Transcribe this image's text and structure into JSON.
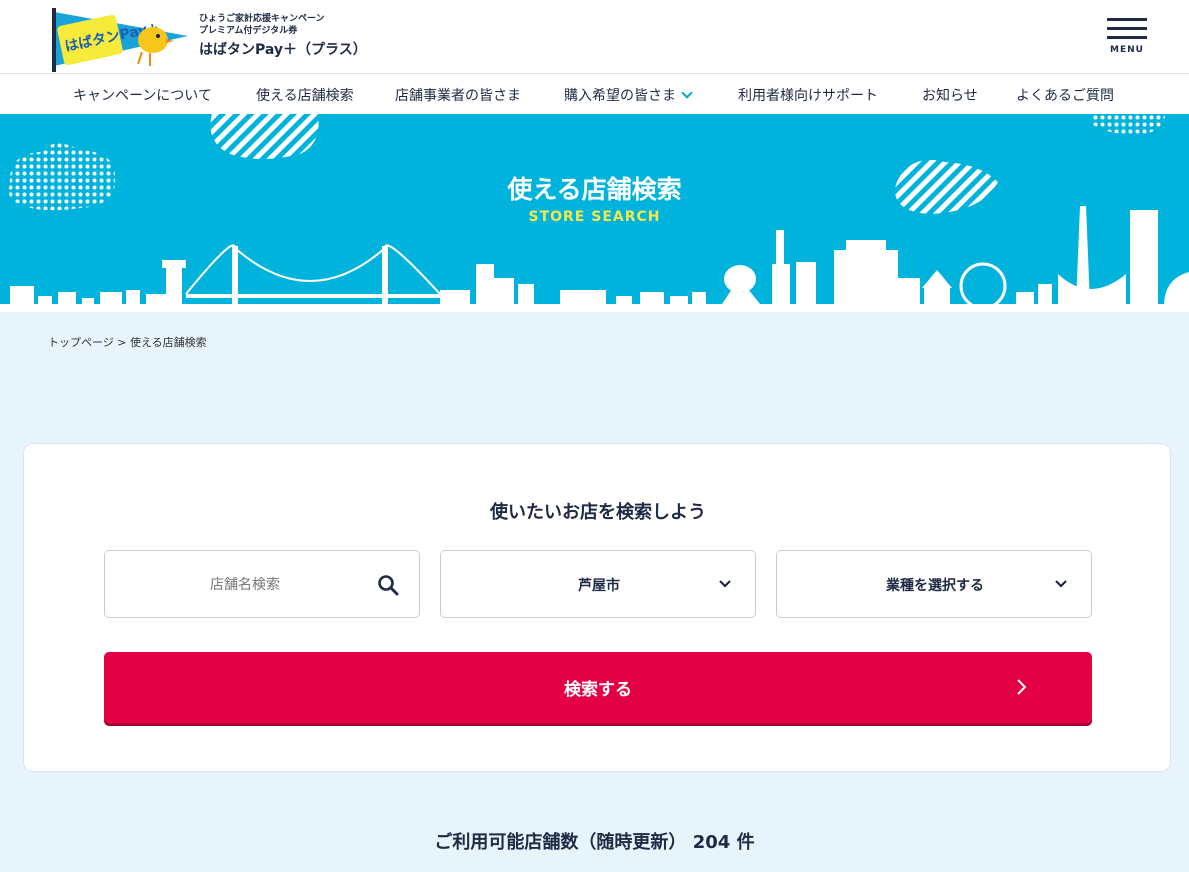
{
  "header": {
    "logo_text": "はばタンPay+",
    "subtitle_1": "ひょうご家計応援キャンペーン",
    "subtitle_2": "プレミアム付デジタル券",
    "title": "はばタンPay＋（プラス）",
    "menu_label": "MENU"
  },
  "nav": {
    "items": [
      {
        "label": "キャンペーンについて"
      },
      {
        "label": "使える店舗検索"
      },
      {
        "label": "店舗事業者の皆さま"
      },
      {
        "label": "購入希望の皆さま"
      },
      {
        "label": "利用者様向けサポート"
      },
      {
        "label": "お知らせ"
      },
      {
        "label": "よくあるご質問"
      }
    ]
  },
  "hero": {
    "title": "使える店舗検索",
    "subtitle": "STORE SEARCH"
  },
  "breadcrumb": {
    "home": "トップページ",
    "separator": " > ",
    "current": "使える店舗検索"
  },
  "search": {
    "title": "使いたいお店を検索しよう",
    "store_placeholder": "店舗名検索",
    "city_value": "芦屋市",
    "category_value": "業種を選択する",
    "submit_label": "検索する"
  },
  "result": {
    "label": "ご利用可能店舗数（随時更新）",
    "count": "204",
    "unit": "件"
  },
  "colors": {
    "primary_text": "#1f2a44",
    "hero_bg": "#00b3dd",
    "accent_yellow": "#f3e94a",
    "submit_red": "#e30044",
    "page_bg": "#e8f4fb"
  },
  "icons": [
    "logo-flag-icon",
    "menu-icon",
    "chevron-down-icon",
    "search-icon",
    "chevron-right-icon"
  ]
}
